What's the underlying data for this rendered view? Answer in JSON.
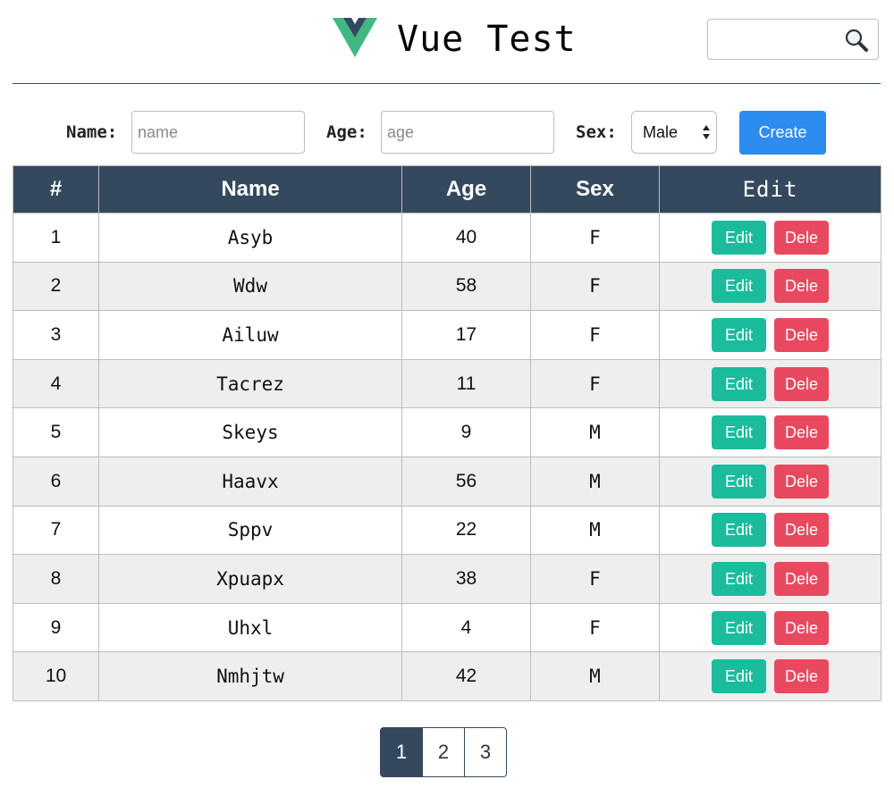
{
  "header": {
    "title": "Vue Test",
    "search": {
      "value": "",
      "placeholder": ""
    }
  },
  "form": {
    "name_label": "Name:",
    "name_placeholder": "name",
    "age_label": "Age:",
    "age_placeholder": "age",
    "sex_label": "Sex:",
    "sex_selected": "Male",
    "create_label": "Create"
  },
  "table": {
    "columns": [
      "#",
      "Name",
      "Age",
      "Sex",
      "Edit"
    ],
    "edit_button_label": "Edit",
    "delete_button_label": "Dele",
    "rows": [
      {
        "num": "1",
        "name": "Asyb",
        "age": "40",
        "sex": "F"
      },
      {
        "num": "2",
        "name": "Wdw",
        "age": "58",
        "sex": "F"
      },
      {
        "num": "3",
        "name": "Ailuw",
        "age": "17",
        "sex": "F"
      },
      {
        "num": "4",
        "name": "Tacrez",
        "age": "11",
        "sex": "F"
      },
      {
        "num": "5",
        "name": "Skeys",
        "age": "9",
        "sex": "M"
      },
      {
        "num": "6",
        "name": "Haavx",
        "age": "56",
        "sex": "M"
      },
      {
        "num": "7",
        "name": "Sppv",
        "age": "22",
        "sex": "M"
      },
      {
        "num": "8",
        "name": "Xpuapx",
        "age": "38",
        "sex": "F"
      },
      {
        "num": "9",
        "name": "Uhxl",
        "age": "4",
        "sex": "F"
      },
      {
        "num": "10",
        "name": "Nmhjtw",
        "age": "42",
        "sex": "M"
      }
    ]
  },
  "pagination": {
    "pages": [
      "1",
      "2",
      "3"
    ],
    "current": "1"
  },
  "colors": {
    "primary_dark": "#35495e",
    "vue_green": "#41b883",
    "create_blue": "#2d8cf0",
    "edit_green": "#1abc9c",
    "delete_red": "#e8495f",
    "row_stripe": "#eeeeee"
  },
  "icons": {
    "logo": "vue-logo-icon",
    "search": "search-icon",
    "select": "select-arrows-icon"
  }
}
